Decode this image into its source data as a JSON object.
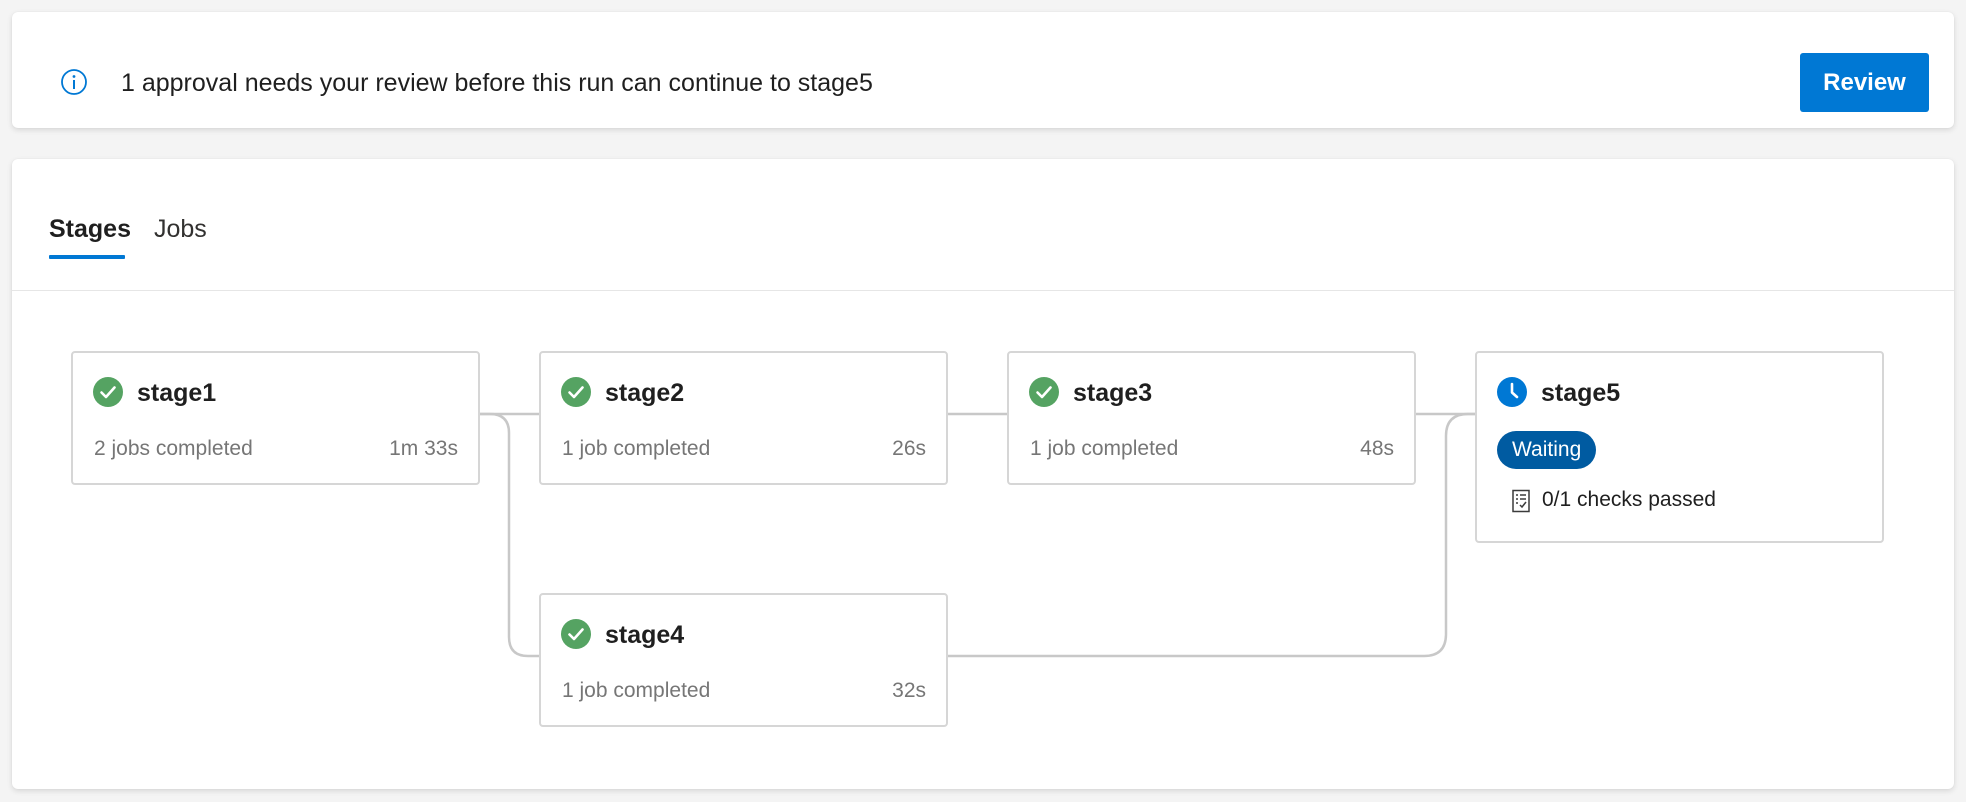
{
  "banner": {
    "message": "1 approval needs your review before this run can continue to stage5",
    "review_label": "Review",
    "icon": "info-icon"
  },
  "tabs": [
    {
      "label": "Stages",
      "active": true
    },
    {
      "label": "Jobs",
      "active": false
    }
  ],
  "stages": {
    "stage1": {
      "name": "stage1",
      "jobs": "2 jobs completed",
      "duration": "1m 33s",
      "status": "succeeded"
    },
    "stage2": {
      "name": "stage2",
      "jobs": "1 job completed",
      "duration": "26s",
      "status": "succeeded"
    },
    "stage3": {
      "name": "stage3",
      "jobs": "1 job completed",
      "duration": "48s",
      "status": "succeeded"
    },
    "stage4": {
      "name": "stage4",
      "jobs": "1 job completed",
      "duration": "32s",
      "status": "succeeded"
    },
    "stage5": {
      "name": "stage5",
      "status_label": "Waiting",
      "checks": "0/1 checks passed",
      "status": "waiting"
    }
  },
  "colors": {
    "accent": "#0078d4",
    "success": "#55a362",
    "waiting_badge": "#005ba1",
    "connector": "#c8c8c8"
  }
}
